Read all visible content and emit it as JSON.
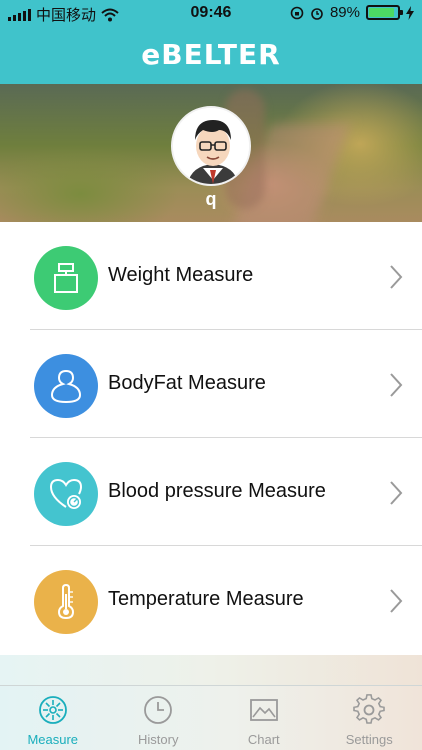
{
  "status_bar": {
    "carrier": "中国移动",
    "time": "09:46",
    "battery_percent": "89%",
    "battery_level": 0.89
  },
  "header": {
    "brand": "eBELTER"
  },
  "profile": {
    "username": "q"
  },
  "measures": [
    {
      "label": "Weight Measure",
      "icon": "scale-weight-icon",
      "color": "#3dcb74"
    },
    {
      "label": "BodyFat Measure",
      "icon": "body-shape-icon",
      "color": "#3d8fe0"
    },
    {
      "label": "Blood pressure Measure",
      "icon": "heart-gauge-icon",
      "color": "#44c4cf"
    },
    {
      "label": "Temperature Measure",
      "icon": "thermometer-icon",
      "color": "#eab24a"
    }
  ],
  "tabs": [
    {
      "label": "Measure",
      "icon": "measure-icon",
      "active": true
    },
    {
      "label": "History",
      "icon": "clock-icon",
      "active": false
    },
    {
      "label": "Chart",
      "icon": "image-chart-icon",
      "active": false
    },
    {
      "label": "Settings",
      "icon": "gear-icon",
      "active": false
    }
  ],
  "colors": {
    "header": "#40c3cb",
    "tab_active": "#1aaebc",
    "tab_inactive": "#9a9a9a"
  }
}
